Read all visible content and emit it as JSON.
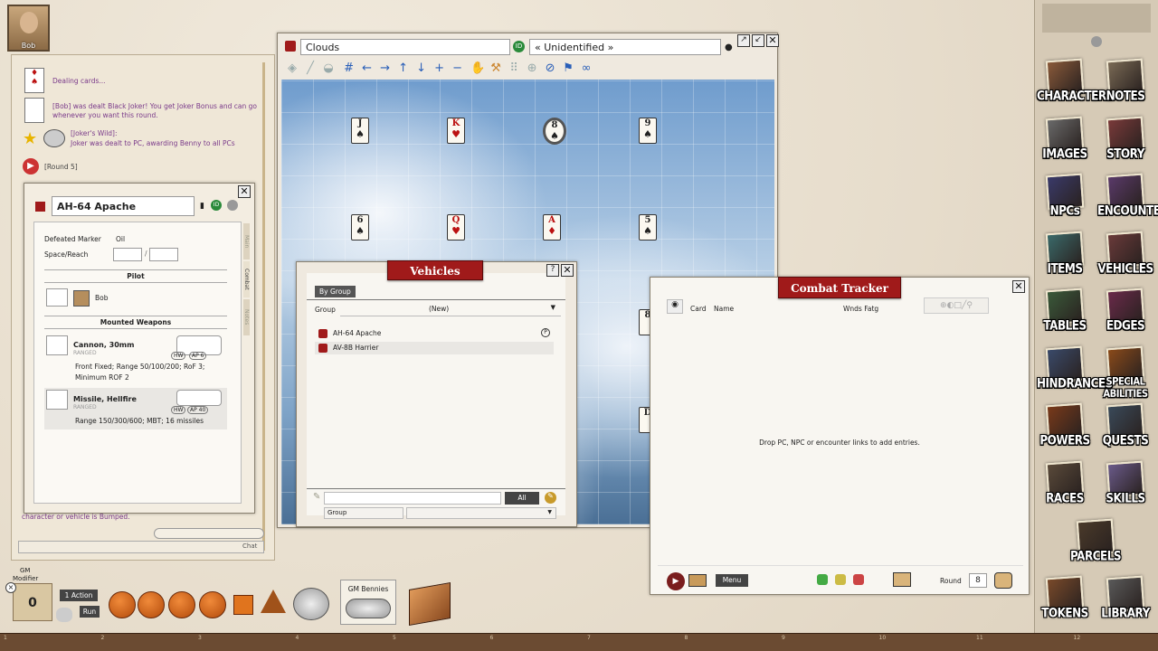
{
  "portrait": {
    "name": "Bob"
  },
  "chat": {
    "lines": [
      "Dealing cards...",
      "[Bob] was dealt Black Joker! You get Joker Bonus and can go",
      "whenever you want this round.",
      "[Joker's Wild]:",
      "Joker was dealt to PC, awarding Benny to all PCs",
      "[Round 5]",
      "character or vehicle is Bumped."
    ],
    "send_label": "Chat"
  },
  "map": {
    "title": "Clouds",
    "id_label": "« Unidentified »",
    "cards": [
      {
        "v": "J",
        "s": "♠",
        "red": false
      },
      {
        "v": "K",
        "s": "♥",
        "red": true
      },
      {
        "v": "8",
        "s": "♠",
        "red": false
      },
      {
        "v": "9",
        "s": "♠",
        "red": false
      },
      {
        "v": "6",
        "s": "♠",
        "red": false
      },
      {
        "v": "Q",
        "s": "♥",
        "red": true
      },
      {
        "v": "A",
        "s": "♦",
        "red": true
      },
      {
        "v": "5",
        "s": "♠",
        "red": false
      },
      {
        "v": "8",
        "s": "",
        "red": false
      },
      {
        "v": "D",
        "s": "",
        "red": false
      }
    ]
  },
  "sheet": {
    "name": "AH-64 Apache",
    "tabs": [
      "Main",
      "Combat",
      "Notes"
    ],
    "defeated_label": "Defeated Marker",
    "defeated_value": "Oil",
    "space_label": "Space/Reach",
    "pilot_header": "Pilot",
    "pilot_name": "Bob",
    "weapons_header": "Mounted Weapons",
    "weapons": [
      {
        "name": "Cannon, 30mm",
        "type": "RANGED",
        "hw": "HW",
        "ap": "AP 6",
        "desc1": "Front Fixed; Range 50/100/200; RoF 3;",
        "desc2": "Minimum ROF 2"
      },
      {
        "name": "Missile, Hellfire",
        "type": "RANGED",
        "hw": "HW",
        "ap": "AP 40",
        "desc1": "Range 150/300/600; MBT; 16 missiles",
        "desc2": ""
      }
    ]
  },
  "vehicles": {
    "title": "Vehicles",
    "by_group": "By Group",
    "group_label": "Group",
    "group_value": "(New)",
    "items": [
      "AH-64 Apache",
      "AV-8B Harrier"
    ],
    "all_label": "All",
    "filter_label": "Group"
  },
  "tracker": {
    "title": "Combat Tracker",
    "col_card": "Card",
    "col_name": "Name",
    "col_wnds": "Wnds Fatg",
    "empty": "Drop PC, NPC or encounter links to add entries.",
    "menu": "Menu",
    "round_label": "Round",
    "round_value": "8"
  },
  "bottom": {
    "gm_label": "GM",
    "modifier_label": "Modifier",
    "modifier_value": "0",
    "action": "1 Action",
    "run": "Run",
    "dice": [
      "d4",
      "d6",
      "d8",
      "d10",
      "d12",
      "d20"
    ],
    "bennies": "GM Bennies"
  },
  "sidebar": {
    "items": [
      "CHARACTERS",
      "NOTES",
      "IMAGES",
      "STORY",
      "NPCs",
      "ENCOUNTERS",
      "ITEMS",
      "VEHICLES",
      "TABLES",
      "EDGES",
      "HINDRANCES",
      "SPECIAL ABILITIES",
      "POWERS",
      "QUESTS",
      "RACES",
      "SKILLS",
      "PARCELS",
      "TOKENS",
      "LIBRARY"
    ]
  },
  "ruler": {
    "ticks": [
      "1",
      "2",
      "3",
      "4",
      "5",
      "6",
      "7",
      "8",
      "9",
      "10",
      "11",
      "12"
    ]
  }
}
